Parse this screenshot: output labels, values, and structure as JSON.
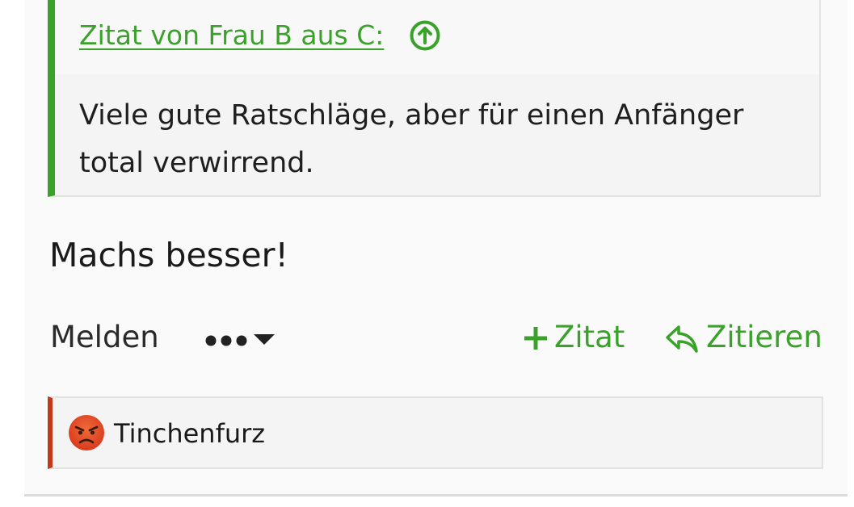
{
  "quote": {
    "link_text": "Zitat von Frau B aus C:",
    "jump_icon": "arrow-up-circle-icon",
    "body": "Viele gute Ratschläge, aber für einen Anfänger total verwirrend."
  },
  "post": {
    "message": "Machs besser!"
  },
  "actions": {
    "report_label": "Melden",
    "more_icon": "more-dots-dropdown-icon",
    "quote_label": "Zitat",
    "quote_icon": "plus-icon",
    "reply_quote_label": "Zitieren",
    "reply_quote_icon": "reply-arrow-icon"
  },
  "reaction": {
    "icon": "angry-face-icon",
    "user": "Tinchenfurz"
  },
  "colors": {
    "accent_green": "#3aa22a",
    "reaction_border_red": "#c5391b",
    "text_dark": "#1a1a1a"
  }
}
